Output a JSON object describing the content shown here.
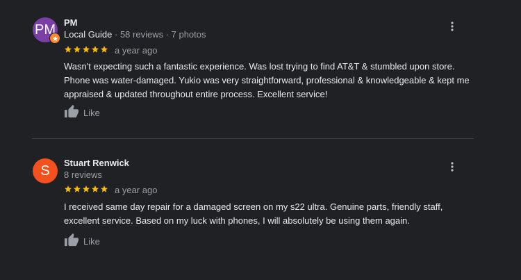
{
  "reviews": [
    {
      "avatar_initials": "PM",
      "avatar_color": "#7b3fa8",
      "name": "PM",
      "badge": "Local Guide",
      "meta": " · 58 reviews · 7 photos",
      "rating": 5,
      "time": "a year ago",
      "text": "Wasn't expecting such a fantastic experience. Was lost trying to find AT&T & stumbled upon store. Phone was water-damaged. Yukio was very straightforward, professional & knowledgeable & kept me appraised & updated throughout entire process. Excellent service!",
      "like_label": "Like"
    },
    {
      "avatar_initials": "S",
      "avatar_color": "#f4511e",
      "name": "Stuart Renwick",
      "badge": "",
      "meta": "8 reviews",
      "rating": 5,
      "time": "a year ago",
      "text": "I received same day repair for a damaged screen on my s22 ultra. Genuine parts, friendly staff, excellent service. Based on my luck with phones, I will absolutely be using them again.",
      "like_label": "Like"
    }
  ],
  "colors": {
    "star": "#fbbc04",
    "background": "#202124"
  },
  "icons": {
    "more": "more-vert-icon",
    "like": "thumb-up-icon",
    "star": "star-icon",
    "guide": "local-guide-star-icon"
  }
}
